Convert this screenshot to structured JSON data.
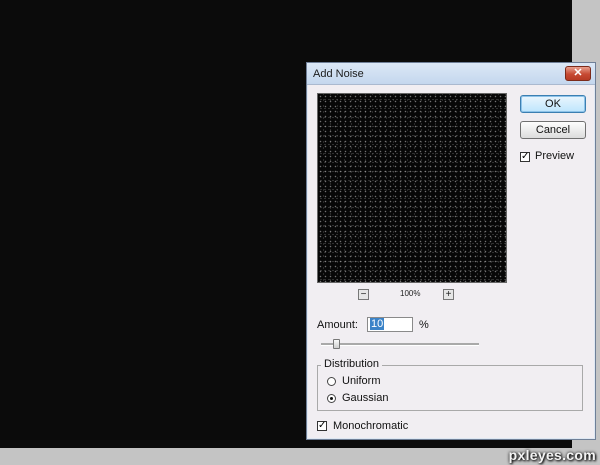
{
  "dialog": {
    "title": "Add Noise",
    "close_glyph": "✕",
    "ok_label": "OK",
    "cancel_label": "Cancel",
    "preview_label": "Preview",
    "preview_checked": true,
    "zoom_out_glyph": "−",
    "zoom_in_glyph": "+",
    "zoom_level": "100%",
    "amount_label": "Amount:",
    "amount_value": "10",
    "amount_unit": "%",
    "amount_slider_fraction": 0.1,
    "distribution": {
      "legend": "Distribution",
      "options": [
        "Uniform",
        "Gaussian"
      ],
      "selected": "Gaussian"
    },
    "monochromatic_label": "Monochromatic",
    "monochromatic_checked": true
  },
  "watermark": "pxleyes.com",
  "icons": {
    "close": "close-icon",
    "zoom_out": "minus-icon",
    "zoom_in": "plus-icon",
    "checkmark": "checkmark-icon"
  },
  "colors": {
    "canvas": "#0b0b0b",
    "dialog_bg": "#f1eef2",
    "close_button": "#c74a33",
    "selection": "#3b83c8"
  }
}
